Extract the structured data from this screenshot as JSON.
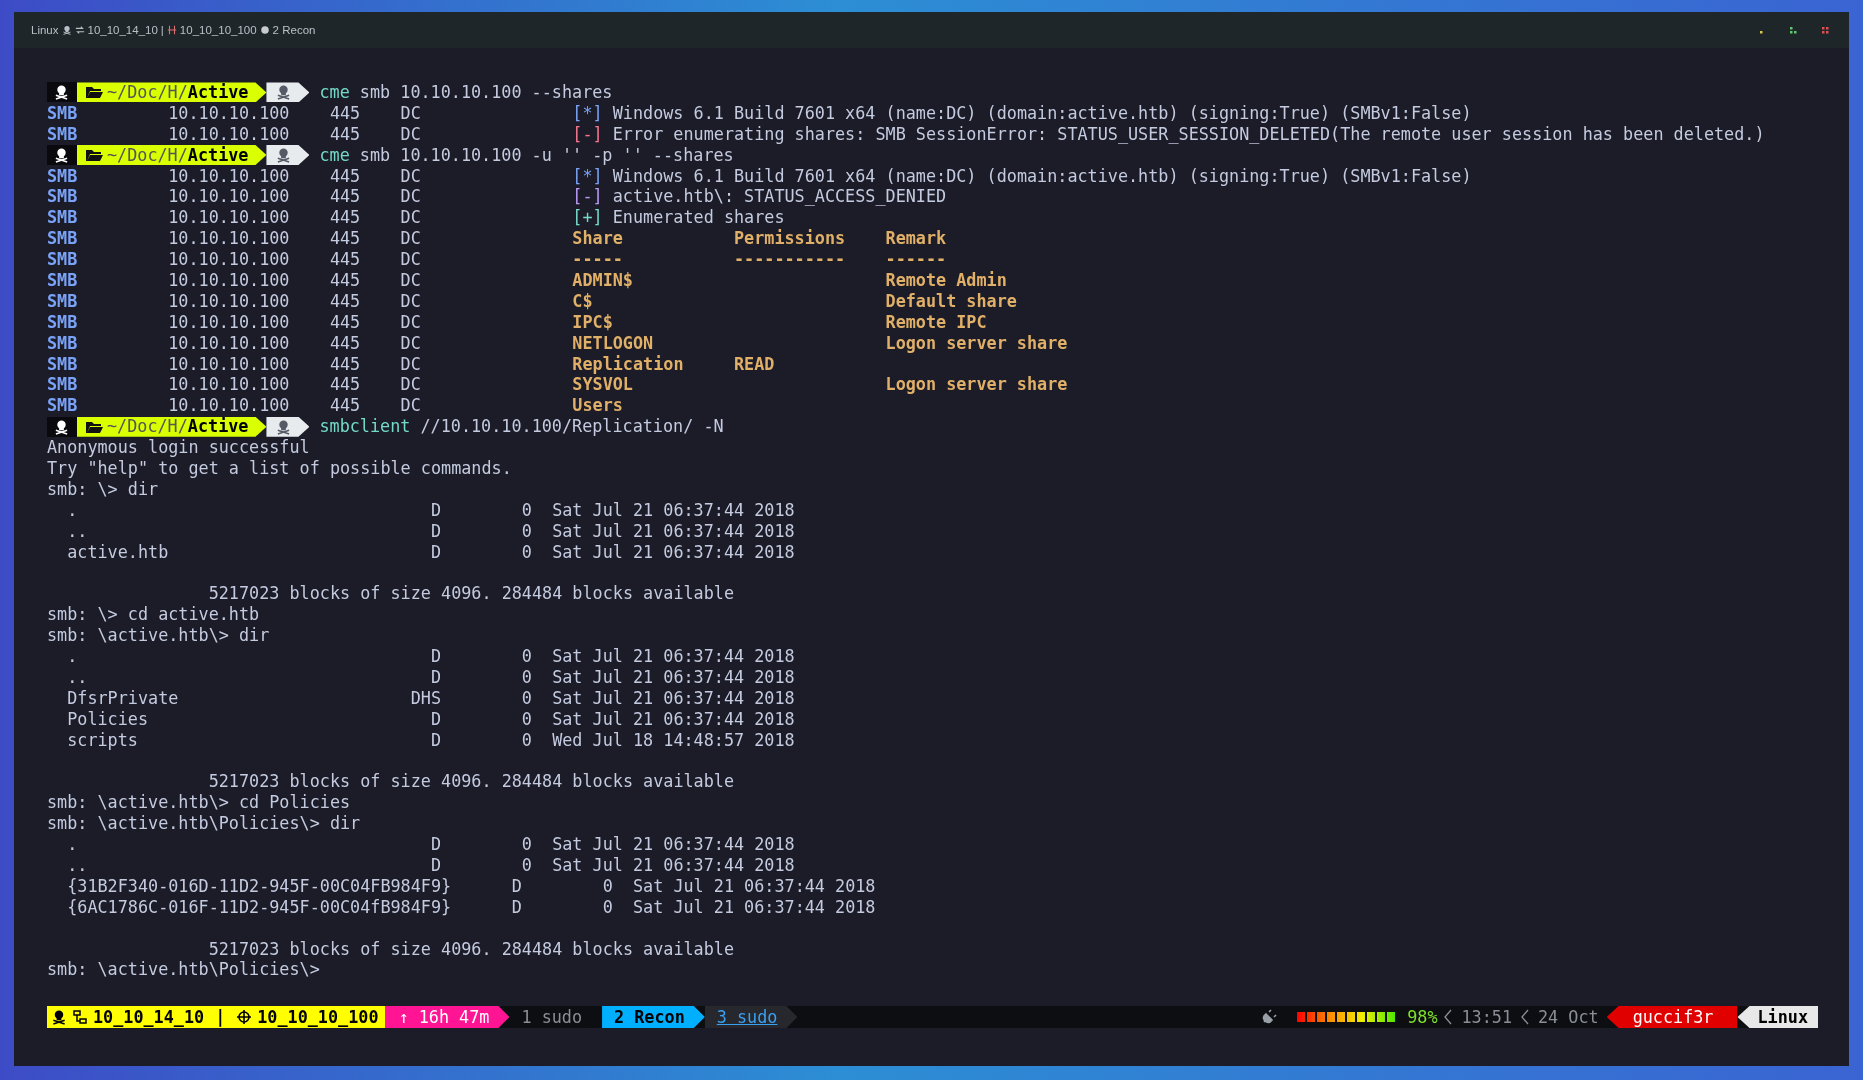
{
  "topbar": {
    "os": "Linux",
    "local_ip": "10_10_14_10",
    "separator": "|",
    "target_ip": "10_10_10_100",
    "window": "2 Recon"
  },
  "terminal": {
    "lines": [
      {
        "kind": "prompt",
        "path": "~/Doc/H/",
        "dir": "Active",
        "program": "cme",
        "args": " smb 10.10.10.100 --shares"
      },
      {
        "kind": "smb",
        "proto": "SMB",
        "host": "10.10.10.100",
        "port": "445",
        "name": "DC",
        "tag": "[*]",
        "color": "#7aa2f7",
        "message": "Windows 6.1 Build 7601 x64 (name:DC) (domain:active.htb) (signing:True) (SMBv1:False)"
      },
      {
        "kind": "smb",
        "proto": "SMB",
        "host": "10.10.10.100",
        "port": "445",
        "name": "DC",
        "tag": "[-]",
        "color": "#f7768e",
        "message": "Error enumerating shares: SMB SessionError: STATUS_USER_SESSION_DELETED(The remote user session has been deleted.)"
      },
      {
        "kind": "prompt",
        "path": "~/Doc/H/",
        "dir": "Active",
        "program": "cme",
        "args": " smb 10.10.10.100 -u '' -p '' --shares"
      },
      {
        "kind": "smb",
        "proto": "SMB",
        "host": "10.10.10.100",
        "port": "445",
        "name": "DC",
        "tag": "[*]",
        "color": "#7aa2f7",
        "message": "Windows 6.1 Build 7601 x64 (name:DC) (domain:active.htb) (signing:True) (SMBv1:False)"
      },
      {
        "kind": "smb",
        "proto": "SMB",
        "host": "10.10.10.100",
        "port": "445",
        "name": "DC",
        "tag": "[-]",
        "color": "#bb9af7",
        "message": "active.htb\\: STATUS_ACCESS_DENIED"
      },
      {
        "kind": "smb",
        "proto": "SMB",
        "host": "10.10.10.100",
        "port": "445",
        "name": "DC",
        "tag": "[+]",
        "color": "#73daca",
        "message": "Enumerated shares"
      },
      {
        "kind": "share",
        "proto": "SMB",
        "host": "10.10.10.100",
        "port": "445",
        "name": "DC",
        "share": "Share",
        "permissions": "Permissions",
        "remark": "Remark"
      },
      {
        "kind": "share",
        "proto": "SMB",
        "host": "10.10.10.100",
        "port": "445",
        "name": "DC",
        "share": "-----",
        "permissions": "-----------",
        "remark": "------"
      },
      {
        "kind": "share",
        "proto": "SMB",
        "host": "10.10.10.100",
        "port": "445",
        "name": "DC",
        "share": "ADMIN$",
        "remark": "Remote Admin"
      },
      {
        "kind": "share",
        "proto": "SMB",
        "host": "10.10.10.100",
        "port": "445",
        "name": "DC",
        "share": "C$",
        "remark": "Default share"
      },
      {
        "kind": "share",
        "proto": "SMB",
        "host": "10.10.10.100",
        "port": "445",
        "name": "DC",
        "share": "IPC$",
        "remark": "Remote IPC"
      },
      {
        "kind": "share",
        "proto": "SMB",
        "host": "10.10.10.100",
        "port": "445",
        "name": "DC",
        "share": "NETLOGON",
        "remark": "Logon server share"
      },
      {
        "kind": "share",
        "proto": "SMB",
        "host": "10.10.10.100",
        "port": "445",
        "name": "DC",
        "share": "Replication",
        "permissions": "READ"
      },
      {
        "kind": "share",
        "proto": "SMB",
        "host": "10.10.10.100",
        "port": "445",
        "name": "DC",
        "share": "SYSVOL",
        "remark": "Logon server share"
      },
      {
        "kind": "share",
        "proto": "SMB",
        "host": "10.10.10.100",
        "port": "445",
        "name": "DC",
        "share": "Users"
      },
      {
        "kind": "prompt",
        "path": "~/Doc/H/",
        "dir": "Active",
        "program": "smbclient",
        "args": " //10.10.10.100/Replication/ -N"
      },
      {
        "kind": "text",
        "text": "Anonymous login successful"
      },
      {
        "kind": "text",
        "text": "Try \"help\" to get a list of possible commands."
      },
      {
        "kind": "text",
        "text": "smb: \\> dir"
      },
      {
        "kind": "text",
        "text": "  .                                   D        0  Sat Jul 21 06:37:44 2018"
      },
      {
        "kind": "text",
        "text": "  ..                                  D        0  Sat Jul 21 06:37:44 2018"
      },
      {
        "kind": "text",
        "text": "  active.htb                          D        0  Sat Jul 21 06:37:44 2018"
      },
      {
        "kind": "blank"
      },
      {
        "kind": "text",
        "text": "                5217023 blocks of size 4096. 284484 blocks available"
      },
      {
        "kind": "text",
        "text": "smb: \\> cd active.htb"
      },
      {
        "kind": "text",
        "text": "smb: \\active.htb\\> dir"
      },
      {
        "kind": "text",
        "text": "  .                                   D        0  Sat Jul 21 06:37:44 2018"
      },
      {
        "kind": "text",
        "text": "  ..                                  D        0  Sat Jul 21 06:37:44 2018"
      },
      {
        "kind": "text",
        "text": "  DfsrPrivate                       DHS        0  Sat Jul 21 06:37:44 2018"
      },
      {
        "kind": "text",
        "text": "  Policies                            D        0  Sat Jul 21 06:37:44 2018"
      },
      {
        "kind": "text",
        "text": "  scripts                             D        0  Wed Jul 18 14:48:57 2018"
      },
      {
        "kind": "blank"
      },
      {
        "kind": "text",
        "text": "                5217023 blocks of size 4096. 284484 blocks available"
      },
      {
        "kind": "text",
        "text": "smb: \\active.htb\\> cd Policies"
      },
      {
        "kind": "text",
        "text": "smb: \\active.htb\\Policies\\> dir"
      },
      {
        "kind": "text",
        "text": "  .                                   D        0  Sat Jul 21 06:37:44 2018"
      },
      {
        "kind": "text",
        "text": "  ..                                  D        0  Sat Jul 21 06:37:44 2018"
      },
      {
        "kind": "text",
        "text": "  {31B2F340-016D-11D2-945F-00C04FB984F9}      D        0  Sat Jul 21 06:37:44 2018"
      },
      {
        "kind": "text",
        "text": "  {6AC1786C-016F-11D2-945F-00C04fB984F9}      D        0  Sat Jul 21 06:37:44 2018"
      },
      {
        "kind": "blank"
      },
      {
        "kind": "text",
        "text": "                5217023 blocks of size 4096. 284484 blocks available"
      },
      {
        "kind": "text",
        "text": "smb: \\active.htb\\Policies\\>"
      }
    ]
  },
  "statusbar": {
    "local_ip": "10_10_14_10",
    "separator": "|",
    "target_ip": "10_10_10_100",
    "uptime": "↑ 16h 47m",
    "windows": [
      {
        "label": "1 sudo",
        "selected": false,
        "activity": false
      },
      {
        "label": "2 Recon",
        "selected": true,
        "activity": false
      },
      {
        "label": "3 sudo",
        "selected": false,
        "activity": true
      }
    ],
    "battery": {
      "level": 0.98,
      "reading": "98%"
    },
    "time": "13:51",
    "date": "24 Oct",
    "user": "guccif3r",
    "host": "Linux"
  }
}
